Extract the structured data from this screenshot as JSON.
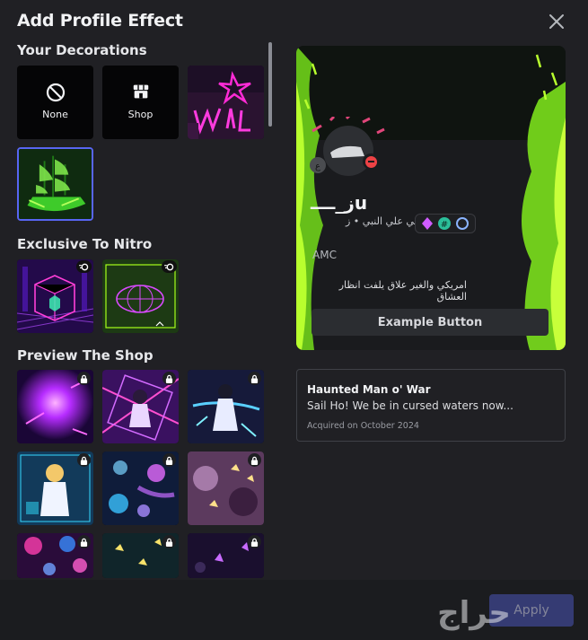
{
  "modal": {
    "title": "Add Profile Effect",
    "close_icon": "close-icon"
  },
  "sections": {
    "decorations": "Your Decorations",
    "nitro": "Exclusive To Nitro",
    "shop": "Preview The Shop"
  },
  "decorations": {
    "none_label": "None",
    "shop_label": "Shop"
  },
  "preview": {
    "display_name": "ز_ــــu",
    "arabic_name": "صلي علي النبي • ز_",
    "pronoun": "AMC",
    "bio": "امريكي والغير علاق يلفت انظار العشاق",
    "example_button": "Example Button"
  },
  "effect_info": {
    "title": "Haunted Man o' War",
    "description": "Sail Ho! We be in cursed waters now...",
    "acquired": "Acquired on October 2024"
  },
  "footer": {
    "apply_label": "Apply",
    "watermark": "حراج"
  },
  "colors": {
    "accent": "#5865f2",
    "neon_green": "#a6ff1a",
    "neon_pink": "#ff2bd6",
    "background": "#202024"
  }
}
